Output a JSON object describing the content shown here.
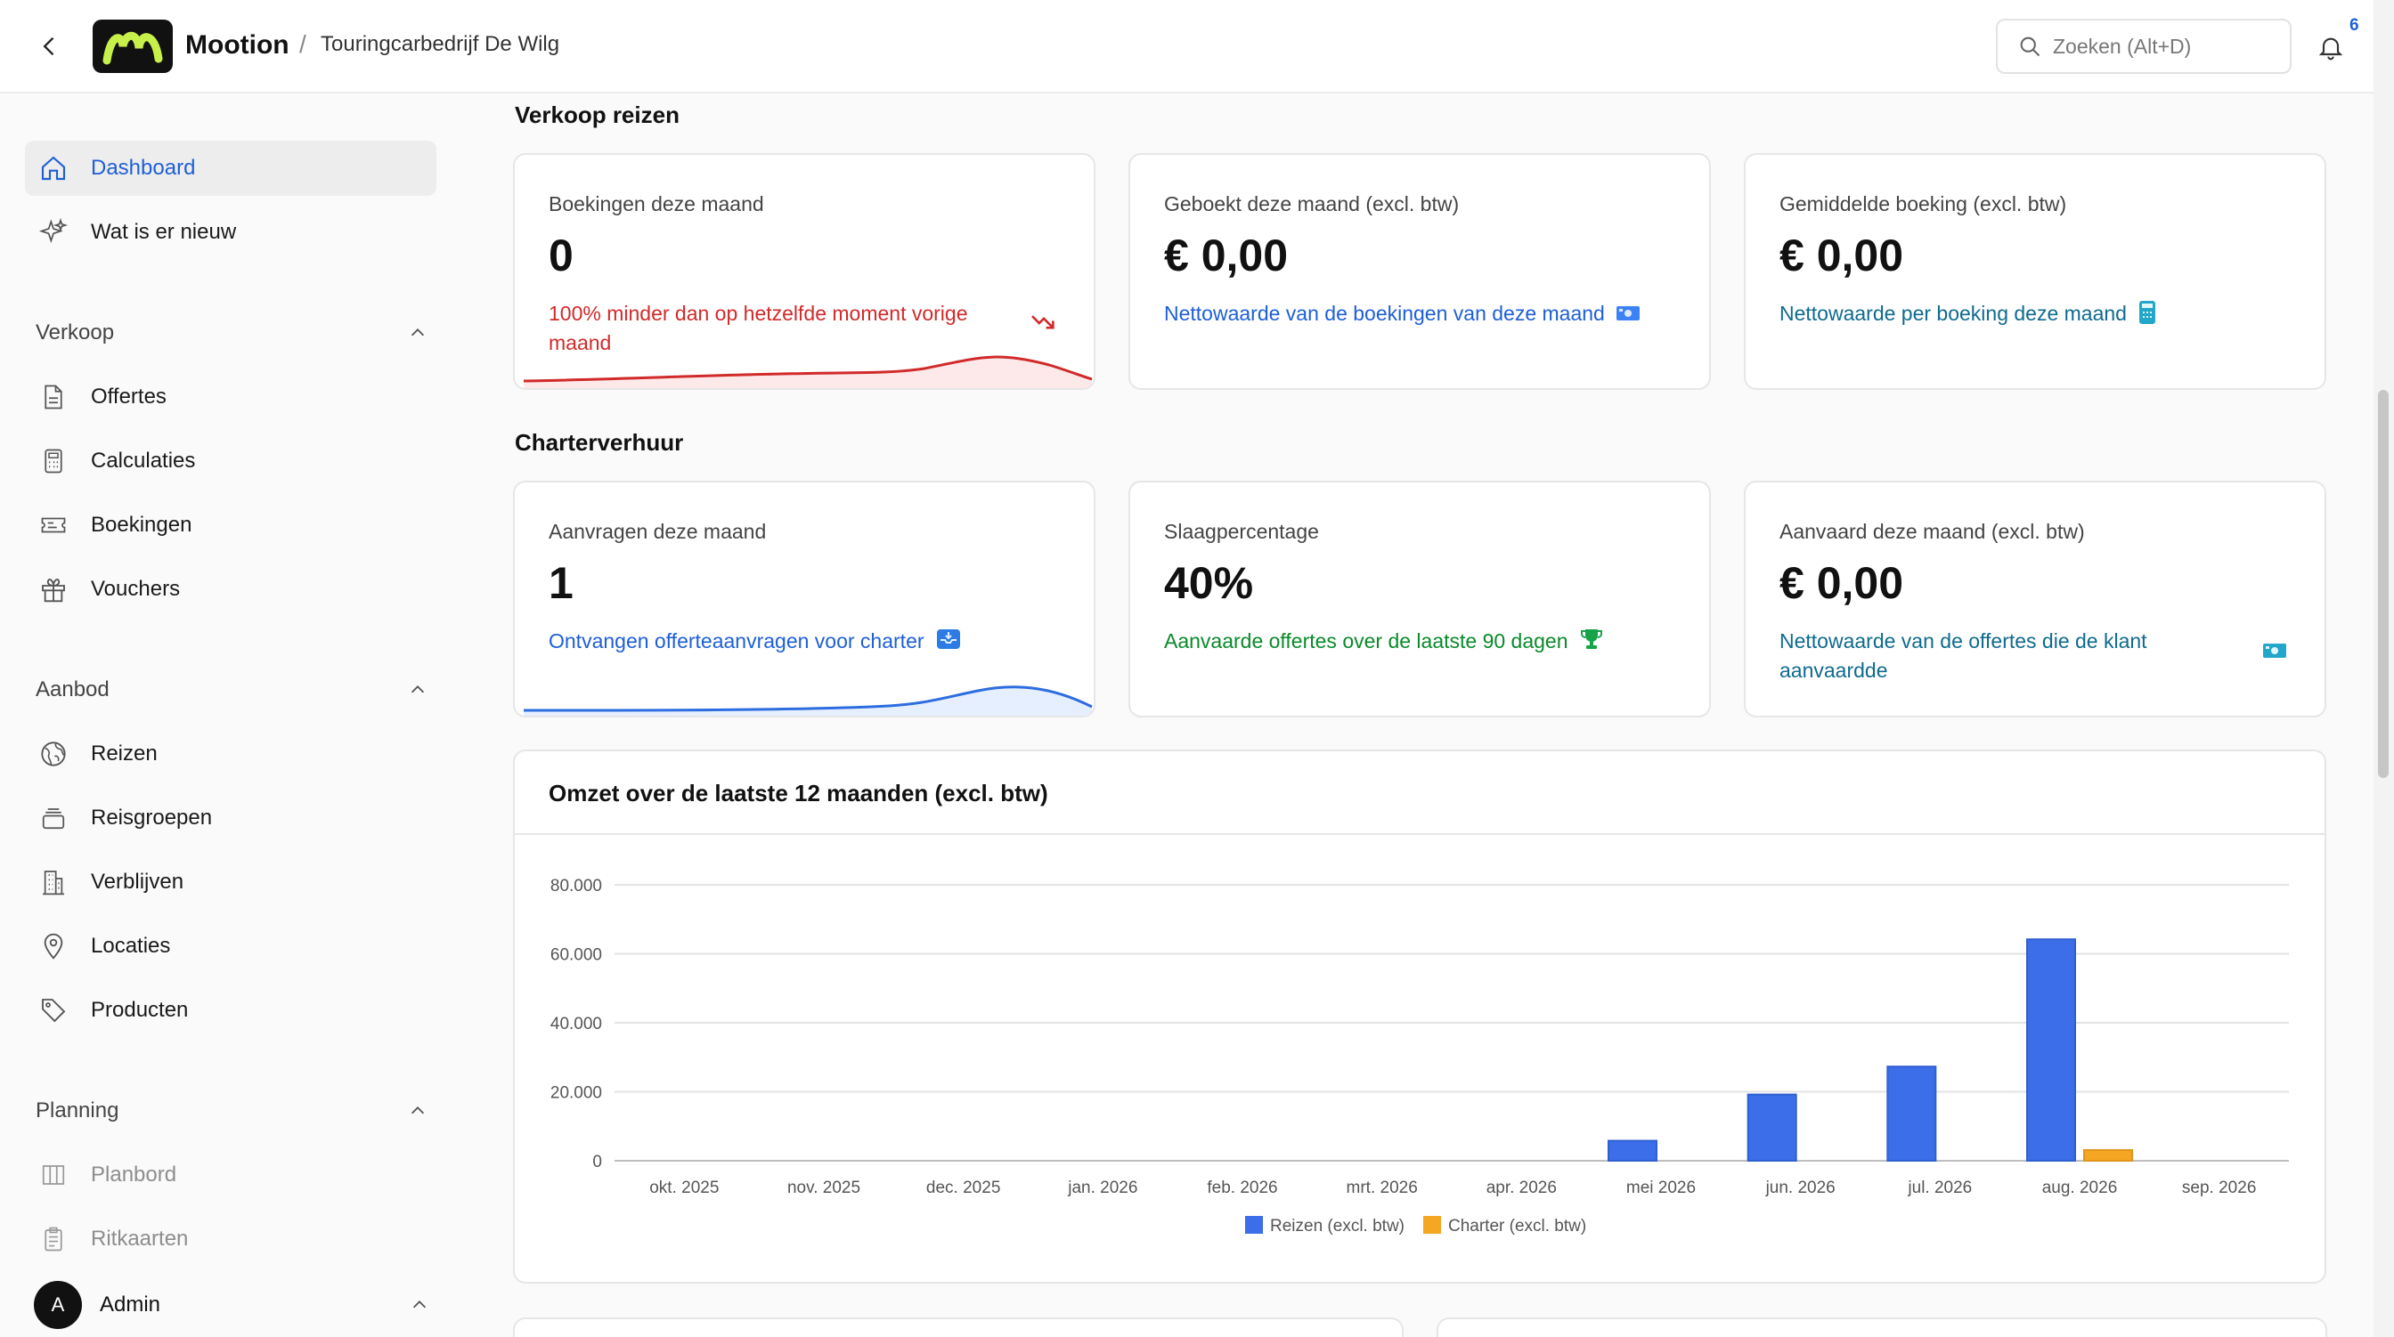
{
  "topbar": {
    "brand": "Mootion",
    "separator": "/",
    "org": "Touringcarbedrijf De Wilg",
    "search_placeholder": "Zoeken (Alt+D)",
    "notification_count": "6"
  },
  "sidebar": {
    "top_items": [
      {
        "label": "Dashboard",
        "icon": "home-icon",
        "active": true
      },
      {
        "label": "Wat is er nieuw",
        "icon": "sparkle-icon"
      }
    ],
    "sections": [
      {
        "title": "Verkoop",
        "items": [
          {
            "label": "Offertes",
            "icon": "document-icon"
          },
          {
            "label": "Calculaties",
            "icon": "calculator-icon"
          },
          {
            "label": "Boekingen",
            "icon": "ticket-icon"
          },
          {
            "label": "Vouchers",
            "icon": "gift-icon"
          }
        ]
      },
      {
        "title": "Aanbod",
        "items": [
          {
            "label": "Reizen",
            "icon": "globe-icon"
          },
          {
            "label": "Reisgroepen",
            "icon": "stack-icon"
          },
          {
            "label": "Verblijven",
            "icon": "building-icon"
          },
          {
            "label": "Locaties",
            "icon": "pin-icon"
          },
          {
            "label": "Producten",
            "icon": "tag-icon"
          }
        ]
      },
      {
        "title": "Planning",
        "items": [
          {
            "label": "Planbord",
            "icon": "board-icon",
            "disabled": true
          },
          {
            "label": "Ritkaarten",
            "icon": "clipboard-icon",
            "disabled": true
          }
        ]
      }
    ],
    "user": {
      "initial": "A",
      "name": "Admin"
    }
  },
  "sales": {
    "title": "Verkoop reizen",
    "cards": [
      {
        "label": "Boekingen deze maand",
        "value": "0",
        "note": "100% minder dan op hetzelfde moment vorige maand",
        "note_color": "#d12a2a",
        "icon": "trending-down-icon"
      },
      {
        "label": "Geboekt deze maand (excl. btw)",
        "value": "€ 0,00",
        "note": "Nettowaarde van de boekingen van deze maand",
        "note_color": "#1e5fd6",
        "icon": "money-icon"
      },
      {
        "label": "Gemiddelde boeking (excl. btw)",
        "value": "€ 0,00",
        "note": "Nettowaarde per boeking deze maand",
        "note_color": "#0f6a8f",
        "icon": "calculator-icon"
      }
    ]
  },
  "charter": {
    "title": "Charterverhuur",
    "cards": [
      {
        "label": "Aanvragen deze maand",
        "value": "1",
        "note": "Ontvangen offerteaanvragen voor charter",
        "note_color": "#1e5fd6",
        "icon": "inbox-icon"
      },
      {
        "label": "Slaagpercentage",
        "value": "40%",
        "note": "Aanvaarde offertes over de laatste 90 dagen",
        "note_color": "#0a8a2a",
        "icon": "trophy-icon"
      },
      {
        "label": "Aanvaard deze maand (excl. btw)",
        "value": "€ 0,00",
        "note": "Nettowaarde van de offertes die de klant aanvaardde",
        "note_color": "#0f6a8f",
        "icon": "money-icon"
      }
    ]
  },
  "chart_data": {
    "type": "bar",
    "title": "Omzet over de laatste 12 maanden (excl. btw)",
    "categories": [
      "okt. 2025",
      "nov. 2025",
      "dec. 2025",
      "jan. 2026",
      "feb. 2026",
      "mrt. 2026",
      "apr. 2026",
      "mei 2026",
      "jun. 2026",
      "jul. 2026",
      "aug. 2026",
      "sep. 2026"
    ],
    "series": [
      {
        "name": "Reizen (excl. btw)",
        "color": "#3b6ee8",
        "values": [
          0,
          0,
          0,
          0,
          0,
          0,
          0,
          5800,
          19200,
          27300,
          64200,
          0
        ]
      },
      {
        "name": "Charter (excl. btw)",
        "color": "#f5a623",
        "values": [
          0,
          0,
          0,
          0,
          0,
          0,
          0,
          0,
          0,
          0,
          3100,
          0
        ]
      }
    ],
    "ylim": [
      0,
      80000
    ],
    "yticks": [
      0,
      20000,
      40000,
      60000,
      80000
    ],
    "ytick_labels": [
      "0",
      "20.000",
      "40.000",
      "60.000",
      "80.000"
    ],
    "grid": true,
    "legend": "bottom"
  }
}
